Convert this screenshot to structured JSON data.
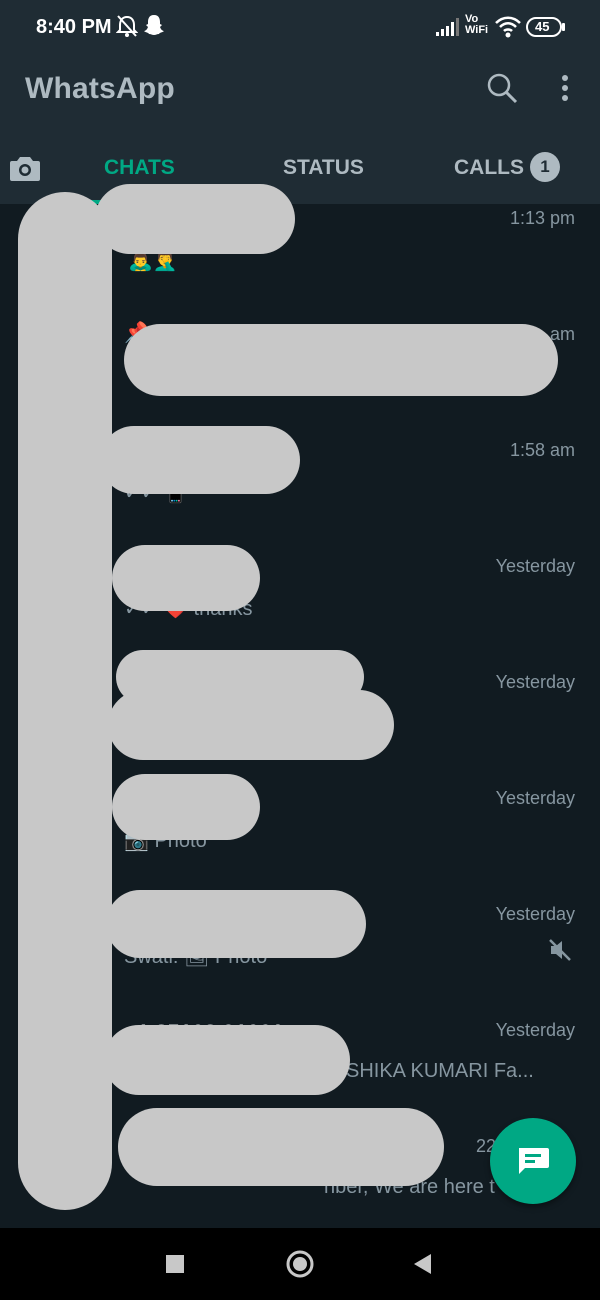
{
  "status_bar": {
    "time": "8:40 PM",
    "battery": "45",
    "icons": [
      "alarm-off-icon",
      "snapchat-icon",
      "signal-icon",
      "vowifi-icon",
      "wifi-icon",
      "battery-icon"
    ],
    "vowifi_top": "Vo",
    "vowifi_bottom": "WiFi"
  },
  "app_bar": {
    "title": "WhatsApp",
    "actions": [
      "search-icon",
      "more-vert-icon"
    ]
  },
  "tabs": [
    {
      "label": "CHATS",
      "active": true
    },
    {
      "label": "STATUS",
      "active": false
    },
    {
      "label": "CALLS",
      "active": false,
      "badge": "1"
    }
  ],
  "chats": [
    {
      "time": "1:13 pm",
      "preview": "🙇‍♂️🤦‍♂️"
    },
    {
      "time": "am",
      "preview": "📌"
    },
    {
      "time": "1:58 am",
      "preview": "✓✓ 📱"
    },
    {
      "time": "Yesterday",
      "preview": "✓✓ ❤️ thanks"
    },
    {
      "time": "Yesterday",
      "preview": ""
    },
    {
      "time": "Yesterday",
      "preview": "📷 Photo"
    },
    {
      "time": "Yesterday",
      "preview": "Swati: 🖼 Photo",
      "muted": true
    },
    {
      "time": "Yesterday",
      "title": "+1 85108 91001",
      "preview": "SHIKA KUMARI  Fa..."
    },
    {
      "time": "22",
      "preview": "nber,  We are here t"
    }
  ],
  "fab": {
    "icon": "new-chat-icon"
  },
  "nav": [
    "recents-square-icon",
    "home-circle-icon",
    "back-triangle-icon"
  ],
  "colors": {
    "accent": "#00a884",
    "background": "#111b21",
    "bar": "#1f2c34"
  }
}
